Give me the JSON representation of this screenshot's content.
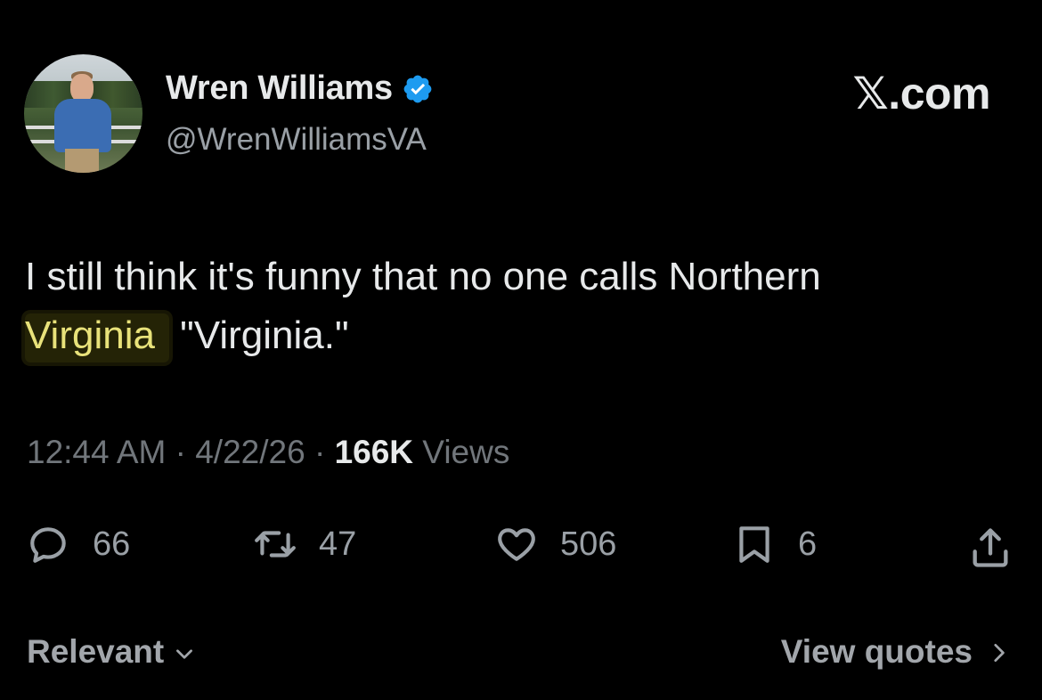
{
  "author": {
    "name": "Wren Williams",
    "handle": "@WrenWilliamsVA",
    "verified_icon": "verified-badge-icon",
    "verified_color": "#1d9bf0"
  },
  "brand": "𝕏.com",
  "tweet": {
    "highlighted": "Virginia",
    "line1": "I still think it's funny that no one calls Northern",
    "line2_after": " \"Virginia.\"",
    "highlight_color": "#e8e27a"
  },
  "meta": {
    "time": "12:44 AM",
    "sep1": " · ",
    "date": "4/22/26",
    "sep2": " · ",
    "views_count": "166K",
    "views_label": " Views"
  },
  "actions": {
    "replies": "66",
    "reposts": "47",
    "likes": "506",
    "bookmarks": "6"
  },
  "footer": {
    "sort_label": "Relevant",
    "view_quotes_label": "View quotes"
  }
}
